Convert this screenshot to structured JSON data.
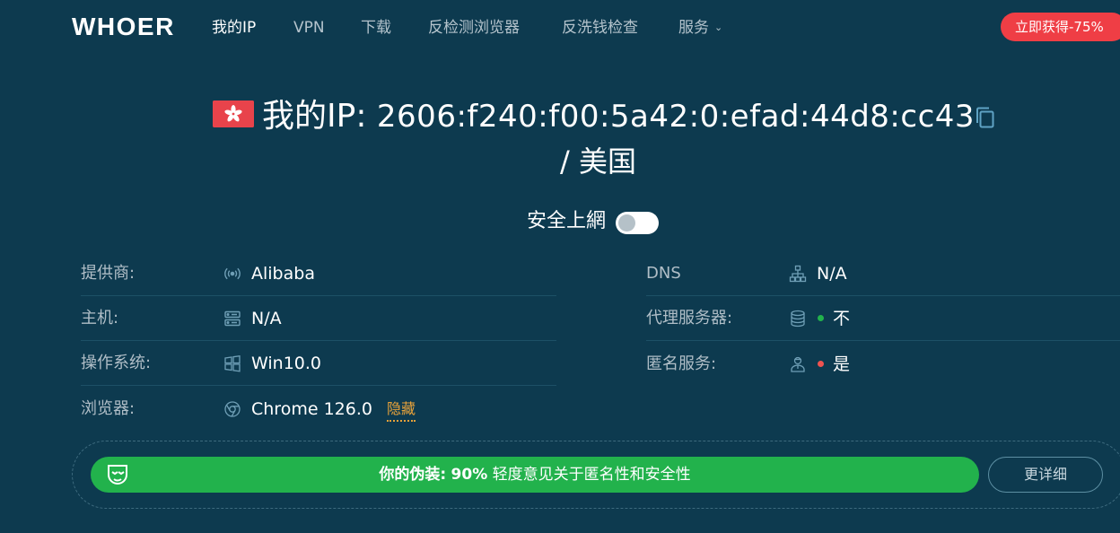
{
  "header": {
    "logo": "WHOER",
    "nav": [
      {
        "label": "我的IP",
        "active": true
      },
      {
        "label": "VPN",
        "active": false
      },
      {
        "label": "下载",
        "active": false
      },
      {
        "label": "反检测浏览器",
        "active": false
      },
      {
        "label": "反洗钱检查",
        "active": false
      },
      {
        "label": "服务",
        "active": false,
        "dropdown": true
      }
    ],
    "nav_caret": "⌄",
    "promo": "立即获得-75%"
  },
  "ip": {
    "label": "我的IP:",
    "value": "2606:f240:f00:5a42:0:efad:44d8:cc43",
    "country": "/ 美国",
    "flag_icon": "hong-kong-flag"
  },
  "secure": {
    "label": "安全上網",
    "enabled": false
  },
  "info_left": [
    {
      "label": "提供商:",
      "icon": "wifi-signal-icon",
      "value": "Alibaba"
    },
    {
      "label": "主机:",
      "icon": "server-icon",
      "value": "N/A"
    },
    {
      "label": "操作系统:",
      "icon": "windows-icon",
      "value": "Win10.0"
    },
    {
      "label": "浏览器:",
      "icon": "chrome-icon",
      "value": "Chrome 126.0",
      "link": "隐藏"
    }
  ],
  "info_right": [
    {
      "label": "DNS",
      "icon": "network-icon",
      "value": "N/A"
    },
    {
      "label": "代理服务器:",
      "icon": "database-icon",
      "status_color": "#22b24c",
      "value": "不"
    },
    {
      "label": "匿名服务:",
      "icon": "user-icon",
      "status_color": "#ef5350",
      "value": "是"
    }
  ],
  "disguise": {
    "prefix": "你的伪装:",
    "percent": "90%",
    "text": "轻度意见关于匿名性和安全性",
    "details": "更详细"
  },
  "colors": {
    "background": "#0d3a4f",
    "accent_green": "#22b24c",
    "promo_red": "#ef3e45",
    "link_orange": "#e8a23a"
  }
}
